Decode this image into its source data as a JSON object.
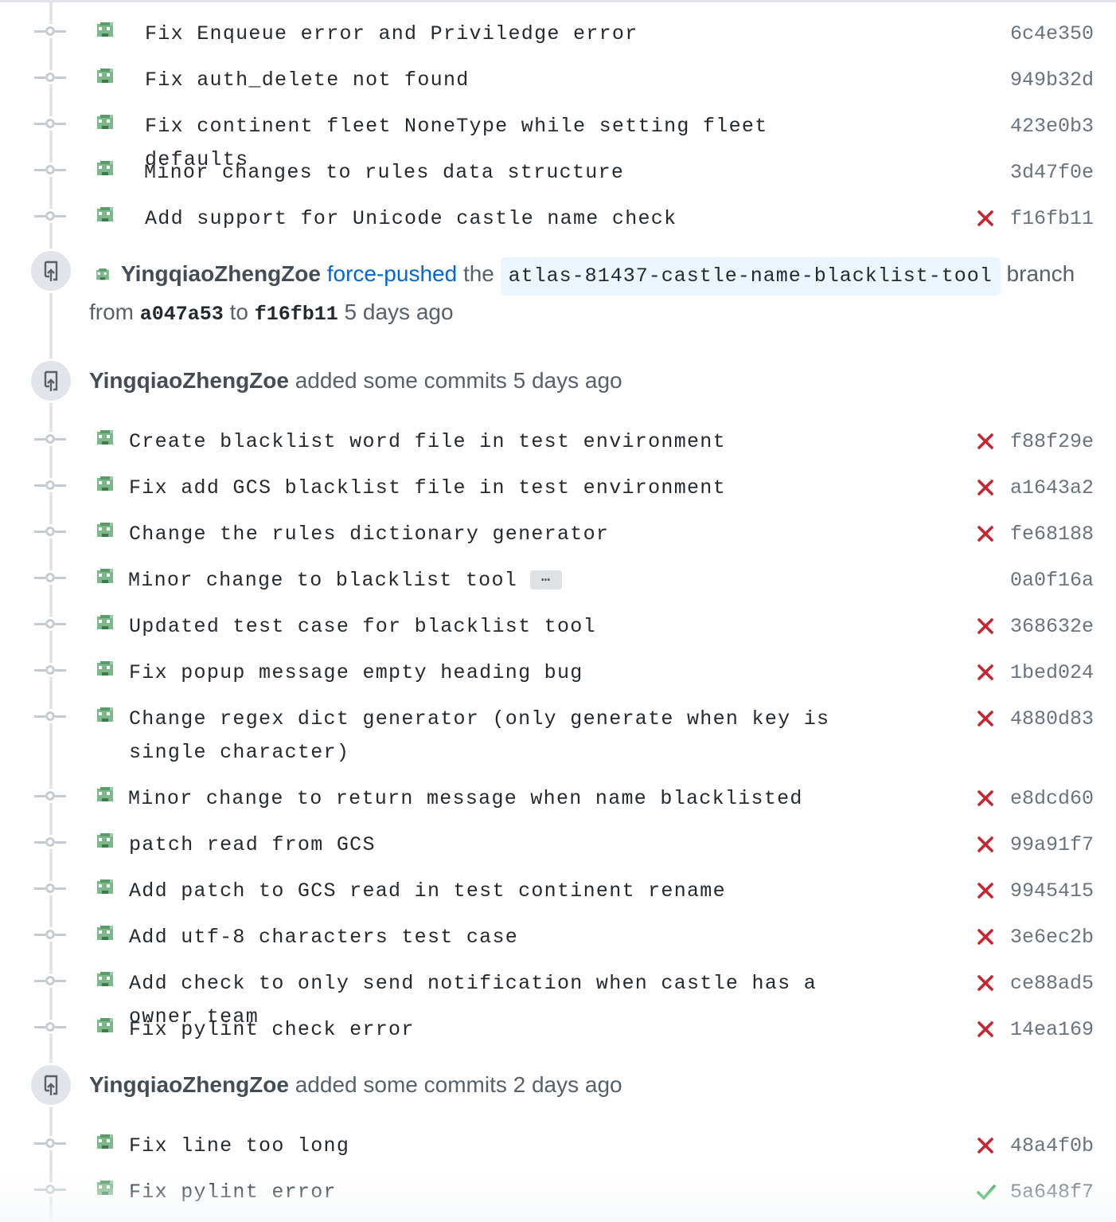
{
  "colors": {
    "fail": "#cb2431",
    "success": "#28a745",
    "link": "#0366d6",
    "sha": "#6a737d"
  },
  "icons": {
    "avatar": "pixel-avatar-icon",
    "node": "commit-node-icon",
    "event": "repo-push-icon",
    "fail": "x-icon",
    "success": "check-icon"
  },
  "group1": {
    "commits": [
      {
        "message": "Fix Enqueue error and Priviledge error",
        "sha": "6c4e350",
        "status": ""
      },
      {
        "message": "Fix auth_delete not found",
        "sha": "949b32d",
        "status": ""
      },
      {
        "message": "Fix continent fleet NoneType while setting fleet defaults",
        "sha": "423e0b3",
        "status": ""
      },
      {
        "message": "Minor changes to rules data structure",
        "sha": "3d47f0e",
        "status": ""
      },
      {
        "message": "Add support for Unicode castle name check",
        "sha": "f16fb11",
        "status": "fail"
      }
    ]
  },
  "force_push": {
    "author": "YingqiaoZhengZoe",
    "action": "force-pushed",
    "the": "the",
    "branch": "atlas-81437-castle-name-blacklist-tool",
    "branch_word": "branch",
    "from_word": "from",
    "from_sha": "a047a53",
    "to_word": "to",
    "to_sha": "f16fb11",
    "time": "5 days ago"
  },
  "event2": {
    "author": "YingqiaoZhengZoe",
    "text": "added some commits 5 days ago"
  },
  "group2": {
    "commits": [
      {
        "message": "Create blacklist word file in test environment",
        "sha": "f88f29e",
        "status": "fail"
      },
      {
        "message": "Fix add GCS blacklist file in test environment",
        "sha": "a1643a2",
        "status": "fail"
      },
      {
        "message": "Change the rules dictionary generator",
        "sha": "fe68188",
        "status": "fail"
      },
      {
        "message": "Minor change to blacklist tool",
        "sha": "0a0f16a",
        "status": "",
        "ellipsis": "…"
      },
      {
        "message": "Updated test case for blacklist tool",
        "sha": "368632e",
        "status": "fail"
      },
      {
        "message": "Fix popup message empty heading bug",
        "sha": "1bed024",
        "status": "fail"
      },
      {
        "message": "Change regex dict generator (only generate when key is single character)",
        "sha": "4880d83",
        "status": "fail"
      },
      {
        "message": "Minor change to return message when name blacklisted",
        "sha": "e8dcd60",
        "status": "fail"
      },
      {
        "message": "patch read from GCS",
        "sha": "99a91f7",
        "status": "fail"
      },
      {
        "message": "Add patch to GCS read in test continent rename",
        "sha": "9945415",
        "status": "fail"
      },
      {
        "message": "Add utf-8 characters test case",
        "sha": "3e6ec2b",
        "status": "fail"
      },
      {
        "message": "Add check to only send notification when castle has a owner team",
        "sha": "ce88ad5",
        "status": "fail"
      },
      {
        "message": "Fix pylint check error",
        "sha": "14ea169",
        "status": "fail"
      }
    ]
  },
  "event3": {
    "author": "YingqiaoZhengZoe",
    "text": "added some commits 2 days ago"
  },
  "group3": {
    "commits": [
      {
        "message": "Fix line too long",
        "sha": "48a4f0b",
        "status": "fail"
      },
      {
        "message": "Fix pylint error",
        "sha": "5a648f7",
        "status": "success"
      }
    ]
  }
}
